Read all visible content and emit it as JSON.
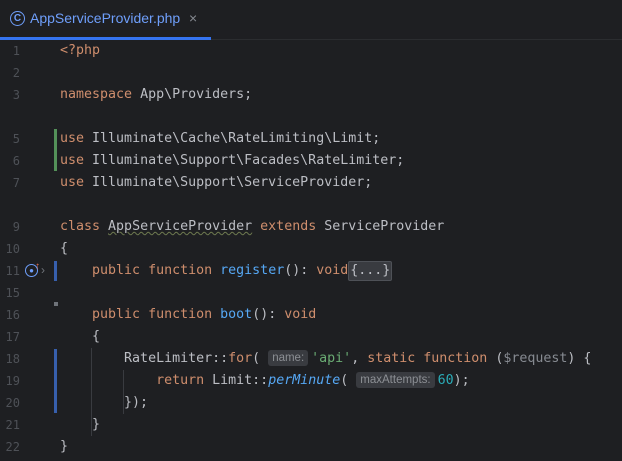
{
  "tab": {
    "icon": "php-class-icon",
    "title": "AppServiceProvider.php",
    "close": "×",
    "accent": "#3574f0"
  },
  "lines": [
    {
      "n": "1"
    },
    {
      "n": "2"
    },
    {
      "n": "3"
    },
    {
      "n": "5"
    },
    {
      "n": "6"
    },
    {
      "n": "7"
    },
    {
      "n": "9"
    },
    {
      "n": "10"
    },
    {
      "n": "11"
    },
    {
      "n": "15"
    },
    {
      "n": "16"
    },
    {
      "n": "17"
    },
    {
      "n": "18"
    },
    {
      "n": "19"
    },
    {
      "n": "20"
    },
    {
      "n": "21"
    },
    {
      "n": "22"
    }
  ],
  "code": {
    "l1": "<?php",
    "l3_kw": "namespace",
    "l3_rest": " App\\Providers;",
    "l5_kw": "use",
    "l5_rest": " Illuminate\\Cache\\RateLimiting\\Limit;",
    "l6_kw": "use",
    "l6_rest": " Illuminate\\Support\\Facades\\RateLimiter;",
    "l7_kw": "use",
    "l7_rest": " Illuminate\\Support\\ServiceProvider;",
    "l9_class": "class",
    "l9_name": "AppServiceProvider",
    "l9_extends": "extends",
    "l9_parent": " ServiceProvider",
    "l10": "{",
    "l11_public": "public",
    "l11_function": "function",
    "l11_name": "register",
    "l11_sig": "(): ",
    "l11_void": "void",
    "l11_fold": "{...}",
    "l16_public": "public",
    "l16_function": "function",
    "l16_name": "boot",
    "l16_sig": "(): ",
    "l16_void": "void",
    "l17": "{",
    "l18_class": "RateLimiter",
    "l18_sep": "::",
    "l18_method": "for",
    "l18_open": "(",
    "l18_hint": "name:",
    "l18_str": "'api'",
    "l18_comma": ", ",
    "l18_static": "static",
    "l18_function": "function",
    "l18_paren": " (",
    "l18_var": "$request",
    "l18_close": ") {",
    "l19_return": "return",
    "l19_class": " Limit",
    "l19_sep": "::",
    "l19_method": "perMinute",
    "l19_open": "(",
    "l19_hint": "maxAttempts:",
    "l19_num": "60",
    "l19_close": ");",
    "l20": "});",
    "l21": "}",
    "l22": "}"
  },
  "gutter": {
    "l11_icons": "implements-icon, override-arrow-icon, fold-chevron-icon"
  },
  "colors": {
    "background": "#1e1f22",
    "keyword": "#cf8e6d",
    "function": "#56a8f5",
    "string": "#6aab73",
    "number": "#2aacb8",
    "variable": "#c77dbb",
    "vcs_added": "#549159",
    "vcs_modified": "#375fad"
  }
}
